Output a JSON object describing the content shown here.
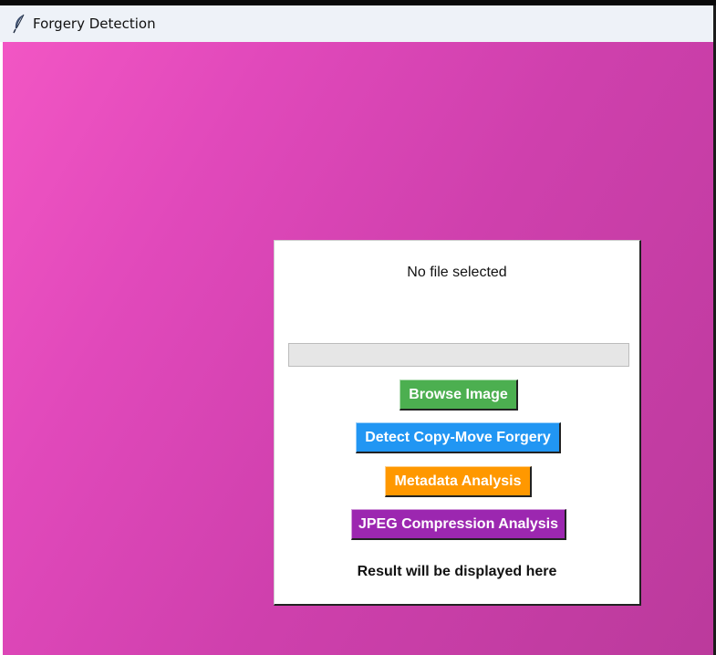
{
  "window": {
    "title": "Forgery Detection",
    "icon": "feather-icon"
  },
  "panel": {
    "file_status": "No file selected",
    "progress_value": 0,
    "buttons": {
      "browse": {
        "label": "Browse Image",
        "color": "#4caf50"
      },
      "detect": {
        "label": "Detect Copy-Move Forgery",
        "color": "#2196f3"
      },
      "metadata": {
        "label": "Metadata Analysis",
        "color": "#ff9800"
      },
      "jpeg": {
        "label": "JPEG Compression Analysis",
        "color": "#9c27b0"
      }
    },
    "result_text": "Result will be displayed here"
  },
  "colors": {
    "background_start": "#f256c4",
    "background_end": "#bb3a9c",
    "panel": "#ffffff"
  }
}
